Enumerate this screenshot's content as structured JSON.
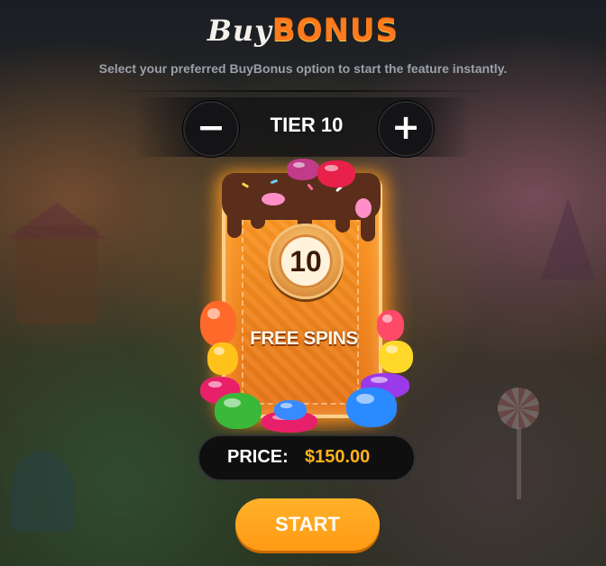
{
  "header": {
    "title_buy": "Buy",
    "title_bonus": "BONUS",
    "subtitle": "Select your preferred BuyBonus option to start the feature instantly."
  },
  "tier": {
    "minus_symbol": "−",
    "plus_symbol": "+",
    "label": "TIER 10"
  },
  "card": {
    "spins_count": "10",
    "caption": "FREE SPINS"
  },
  "price": {
    "label": "PRICE:",
    "value": "$150.00"
  },
  "actions": {
    "start_label": "START"
  },
  "colors": {
    "accent_orange": "#ff7a1c",
    "price_gold": "#ffb21f",
    "start_button": "#ff9a14",
    "card_orange": "#f28a1f"
  },
  "icons": {
    "minus": "minus-icon",
    "plus": "plus-icon"
  }
}
